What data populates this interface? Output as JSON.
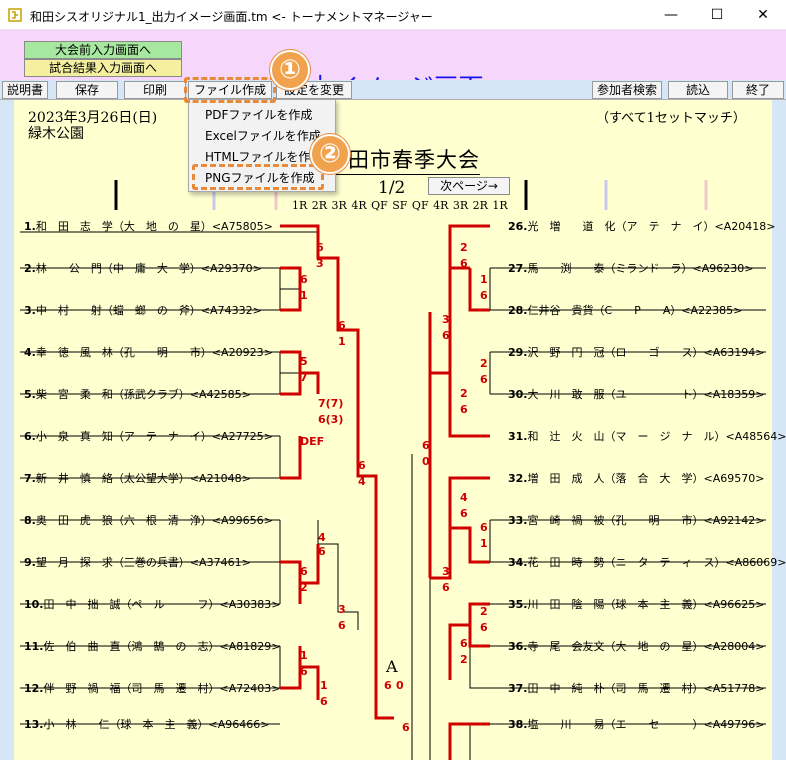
{
  "window": {
    "title": "和田シスオリジナル1_出力イメージ画面.tm <- トーナメントマネージャー",
    "min": "—",
    "max": "☐",
    "close": "✕"
  },
  "header": {
    "nav1": "大会前入力画面へ",
    "nav2": "試合結果入力画面へ",
    "title": "出力イメージ画面"
  },
  "toolbar": {
    "help": "説明書",
    "save": "保存",
    "print": "印刷",
    "file": "ファイル作成",
    "settings": "設定を変更",
    "participants": "参加者検索",
    "load": "読込",
    "exit": "終了"
  },
  "file_menu": {
    "items": [
      "PDFファイルを作成",
      "Excelファイルを作成",
      "HTMLファイルを作成",
      "PNGファイルを作成"
    ]
  },
  "callouts": {
    "c1": "①",
    "c2": "②"
  },
  "sheet": {
    "date": "2023年3月26日(日)",
    "venue": "緑木公園",
    "match_format": "（すべて1セットマッチ）",
    "tournament": "和田市春季大会",
    "page": "1/2",
    "next_page": "次ページ→",
    "rounds": "1R 2R 3R 4R QF SF QF 4R 3R 2R 1R",
    "final_label": "A"
  },
  "colors": {
    "accent_red": "#d00000",
    "title_blue": "#1515ee",
    "paper": "#ffffd0",
    "header_pink": "#f6d6fa",
    "toolbar_blue": "#d6e6f7",
    "callout_orange": "#f0a24d"
  },
  "players_left": [
    {
      "no": "1.",
      "name": "和　田　志　学",
      "team": "（大　地　の　星）",
      "id": "<A75805>"
    },
    {
      "no": "2.",
      "name": "林　　公　門",
      "team": "（中　庸　大　学）",
      "id": "<A29370>"
    },
    {
      "no": "3.",
      "name": "中　村　　射",
      "team": "（蟷　螂　の　斧）",
      "id": "<A74332>"
    },
    {
      "no": "4.",
      "name": "幸　徳　風　林",
      "team": "（孔　　明　　市）",
      "id": "<A20923>"
    },
    {
      "no": "5.",
      "name": "柴　宮　柔　和",
      "team": "（孫武クラブ）",
      "id": "<A42585>"
    },
    {
      "no": "6.",
      "name": "小　泉　真　知",
      "team": "（ア　テ　ナ　イ）",
      "id": "<A27725>"
    },
    {
      "no": "7.",
      "name": "新　井　慎　絡",
      "team": "（太公望大学）",
      "id": "<A21048>"
    },
    {
      "no": "8.",
      "name": "奥　田　虎　狼",
      "team": "（六　根　清　浄）",
      "id": "<A99656>"
    },
    {
      "no": "9.",
      "name": "望　月　探　求",
      "team": "（三巻の兵書）",
      "id": "<A37461>"
    },
    {
      "no": "10.",
      "name": "田　中　拙　誠",
      "team": "（ペ　ル　ー　フ）",
      "id": "<A30383>"
    },
    {
      "no": "11.",
      "name": "佐　伯　曲　直",
      "team": "（鴻　鵠　の　志）",
      "id": "<A81829>"
    },
    {
      "no": "12.",
      "name": "伴　野　禍　福",
      "team": "（司　馬　遷　村）",
      "id": "<A72403>"
    },
    {
      "no": "13.",
      "name": "小　林　　仁",
      "team": "（球　本　主　義）",
      "id": "<A96466>"
    }
  ],
  "players_right": [
    {
      "no": "26.",
      "name": "光　増　　道　化",
      "team": "（ア　テ　ナ　イ）",
      "id": "<A20418>"
    },
    {
      "no": "27.",
      "name": "馬　　渕　　泰",
      "team": "（ミランドーラ）",
      "id": "<A96230>"
    },
    {
      "no": "28.",
      "name": "仁井谷　貴貨",
      "team": "（C　　P　　A）",
      "id": "<A22385>"
    },
    {
      "no": "29.",
      "name": "沢　野　円　冠",
      "team": "（ロ　　ゴ　　ス）",
      "id": "<A63194>"
    },
    {
      "no": "30.",
      "name": "大　川　敢　服",
      "team": "（ユ　　ー　　ト）",
      "id": "<A18359>"
    },
    {
      "no": "31.",
      "name": "和　辻　火　山",
      "team": "（マ　ー　ジ　ナ　ル）",
      "id": "<A48564>"
    },
    {
      "no": "32.",
      "name": "増　田　成　人",
      "team": "（落　合　大　学）",
      "id": "<A69570>"
    },
    {
      "no": "33.",
      "name": "宮　崎　禍　被",
      "team": "（孔　　明　　市）",
      "id": "<A92142>"
    },
    {
      "no": "34.",
      "name": "花　田　時　勢",
      "team": "（ニ　タ　テ　ィ　ス）",
      "id": "<A86069>"
    },
    {
      "no": "35.",
      "name": "川　田　陰　陽",
      "team": "（球　本　主　義）",
      "id": "<A96625>"
    },
    {
      "no": "36.",
      "name": "寺　尾　会友文",
      "team": "（大　地　の　星）",
      "id": "<A28004>"
    },
    {
      "no": "37.",
      "name": "田　中　純　朴",
      "team": "（司　馬　遷　村）",
      "id": "<A51778>"
    },
    {
      "no": "38.",
      "name": "塩　　川　　易",
      "team": "（エ　　セ　　ー）",
      "id": "<A49796>"
    }
  ],
  "scores": [
    "6",
    "3",
    "6",
    "1",
    "6",
    "1",
    "5",
    "7",
    "7(7)",
    "6(3)",
    "DEF",
    "4",
    "6",
    "6",
    "2",
    "3",
    "6",
    "1",
    "6",
    "1",
    "6",
    "6",
    "4",
    "2",
    "6",
    "1",
    "6",
    "3",
    "6",
    "2",
    "6",
    "6",
    "0",
    "2",
    "6",
    "4",
    "6",
    "6",
    "1",
    "3",
    "6",
    "6",
    "2",
    "2",
    "6",
    "6",
    "0",
    "6"
  ]
}
